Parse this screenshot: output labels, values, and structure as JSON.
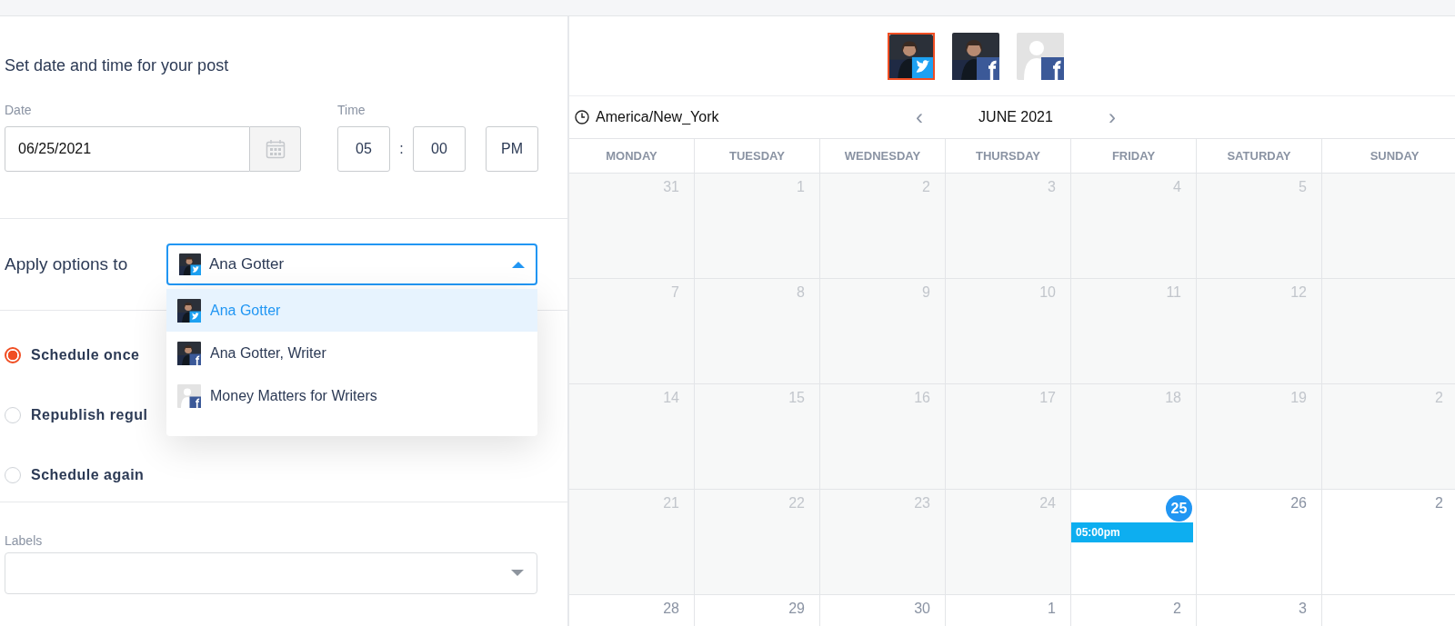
{
  "schedule": {
    "heading": "Set date and time for your post",
    "date_label": "Date",
    "date_value": "06/25/2021",
    "time_label": "Time",
    "hour": "05",
    "separator": ":",
    "minute": "00",
    "meridiem": "PM"
  },
  "apply": {
    "label": "Apply options to",
    "selected_profile": {
      "name": "Ana Gotter",
      "kind": "photo-twitter"
    },
    "expanded": true,
    "options": [
      {
        "name": "Ana Gotter",
        "kind": "photo-twitter",
        "selected": true
      },
      {
        "name": "Ana Gotter, Writer",
        "kind": "photo-facebook",
        "selected": false
      },
      {
        "name": "Money Matters for Writers",
        "kind": "placeholder-facebook",
        "selected": false
      }
    ]
  },
  "repeat_options": [
    {
      "label": "Schedule once",
      "selected": true
    },
    {
      "label": "Republish regul",
      "selected": false
    },
    {
      "label": "Schedule again",
      "selected": false
    }
  ],
  "labels": {
    "label": "Labels"
  },
  "profiles": [
    {
      "kind": "photo-twitter",
      "selected": true
    },
    {
      "kind": "photo-facebook",
      "selected": false
    },
    {
      "kind": "placeholder-facebook",
      "selected": false
    }
  ],
  "calendar": {
    "timezone": "America/New_York",
    "prev": "‹",
    "month": "JUNE 2021",
    "next": "›",
    "weekdays": [
      "MONDAY",
      "TUESDAY",
      "WEDNESDAY",
      "THURSDAY",
      "FRIDAY",
      "SATURDAY",
      "SUNDAY"
    ],
    "weeks": [
      [
        {
          "day": "31",
          "past": true
        },
        {
          "day": "1",
          "past": true
        },
        {
          "day": "2",
          "past": true
        },
        {
          "day": "3",
          "past": true
        },
        {
          "day": "4",
          "past": true
        },
        {
          "day": "5",
          "past": true
        }
      ],
      [
        {
          "day": "7",
          "past": true
        },
        {
          "day": "8",
          "past": true
        },
        {
          "day": "9",
          "past": true
        },
        {
          "day": "10",
          "past": true
        },
        {
          "day": "11",
          "past": true
        },
        {
          "day": "12",
          "past": true
        }
      ],
      [
        {
          "day": "14",
          "past": true
        },
        {
          "day": "15",
          "past": true
        },
        {
          "day": "16",
          "past": true
        },
        {
          "day": "17",
          "past": true
        },
        {
          "day": "18",
          "past": true
        },
        {
          "day": "19",
          "past": true
        },
        {
          "day": "2",
          "past": true
        }
      ],
      [
        {
          "day": "21",
          "past": true
        },
        {
          "day": "22",
          "past": true
        },
        {
          "day": "23",
          "past": true
        },
        {
          "day": "24",
          "past": true
        },
        {
          "day": "25",
          "past": false,
          "today": true,
          "events": [
            "05:00pm"
          ]
        },
        {
          "day": "26",
          "past": false
        },
        {
          "day": "2",
          "past": false
        }
      ],
      [
        {
          "day": "28",
          "past": false
        },
        {
          "day": "29",
          "past": false
        },
        {
          "day": "30",
          "past": false
        },
        {
          "day": "1",
          "past": false
        },
        {
          "day": "2",
          "past": false
        },
        {
          "day": "3",
          "past": false
        }
      ]
    ]
  }
}
